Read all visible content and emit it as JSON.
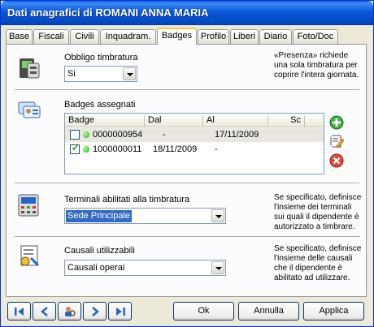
{
  "window": {
    "title": "Dati anagrafici di ROMANI ANNA MARIA"
  },
  "tabs": [
    {
      "label": "Base"
    },
    {
      "label": "Fiscali"
    },
    {
      "label": "Civili"
    },
    {
      "label": "Inquadram."
    },
    {
      "label": "Badges",
      "active": true
    },
    {
      "label": "Profilo"
    },
    {
      "label": "Liberi"
    },
    {
      "label": "Diario"
    },
    {
      "label": "Foto/Doc"
    }
  ],
  "timbratura": {
    "label": "Obbligo timbratura",
    "value": "Si",
    "note": "«Presenza» richiede una sola timbratura per coprire l'intera giornata."
  },
  "badges": {
    "label": "Badges assegnati",
    "columns": [
      "Badge",
      "Dal",
      "Al",
      "Sc"
    ],
    "rows": [
      {
        "checked": false,
        "badge": "0000000954",
        "dal": "-",
        "al": "17/11/2009",
        "sc": ""
      },
      {
        "checked": true,
        "badge": "1000000011",
        "dal": "18/11/2009",
        "al": "-",
        "sc": ""
      }
    ]
  },
  "terminali": {
    "label": "Terminali abilitati alla timbratura",
    "value": "Sede Principale",
    "note": "Se specificato, definisce l'insieme dei terminali sui quali il dipendente è autorizzato a timbrare."
  },
  "causali": {
    "label": "Causali utilizzabili",
    "value": "Causali operai",
    "note": "Se specificato, definisce l'insieme delle causali che il dipendente è abilitato ad utilizzare."
  },
  "buttons": {
    "ok": "Ok",
    "cancel": "Annulla",
    "apply": "Applica"
  },
  "colors": {
    "titlebar": "#0a58d8",
    "active_tab_accent": "#ffc83c",
    "selection": "#316ac5"
  }
}
